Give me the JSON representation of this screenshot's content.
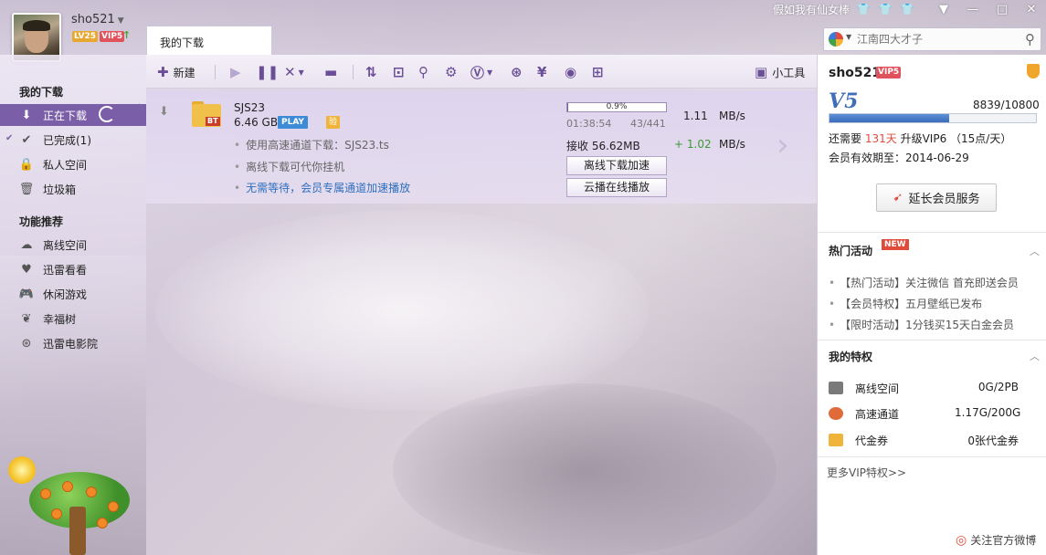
{
  "header": {
    "username": "sho521",
    "level_badge": "LV25",
    "vip_badge": "VIP5",
    "tab_label": "我的下载",
    "marquee": "假如我有仙女棒",
    "search": {
      "placeholder": "江南四大才子"
    }
  },
  "sidebar": {
    "section_downloads": "我的下载",
    "items": [
      {
        "label": "正在下载"
      },
      {
        "label": "已完成(1)"
      },
      {
        "label": "私人空间"
      },
      {
        "label": "垃圾箱"
      }
    ],
    "section_features": "功能推荐",
    "features": [
      {
        "label": "离线空间"
      },
      {
        "label": "迅雷看看"
      },
      {
        "label": "休闲游戏"
      },
      {
        "label": "幸福树"
      },
      {
        "label": "迅雷电影院"
      }
    ]
  },
  "toolbar": {
    "new_label": "新建",
    "tools_label": "小工具"
  },
  "task": {
    "name": "SJS23",
    "size": "6.46 GB",
    "play_badge": "PLAY",
    "verify_badge": "验",
    "tips": [
      "使用高速通道下载：SJS23.ts",
      "离线下载可代你挂机",
      "无需等待，会员专属通道加速播放"
    ],
    "progress": 0.009,
    "progress_text": "0.9%",
    "eta": "01:38:54",
    "blocks": "43/441",
    "speed": "1.11",
    "speed_unit": "MB/s",
    "received": "接收 56.62MB",
    "boost": "+ 1.02",
    "boost_unit": "MB/s",
    "btn_offline": "离线下载加速",
    "btn_cloud": "云播在线播放"
  },
  "vip_panel": {
    "username": "sho521",
    "vip_badge": "VIP5",
    "level": "V5",
    "score": "8839/10800",
    "score_fraction": 0.58,
    "need_prefix": "还需要",
    "need_days": "131天",
    "need_suffix": "升级VIP6 （15点/天）",
    "expiry": "会员有效期至：2014-06-29",
    "extend_button": "延长会员服务",
    "hot_title": "热门活动",
    "new_badge": "NEW",
    "news": [
      "【热门活动】关注微信 首充即送会员",
      "【会员特权】五月壁纸已发布",
      "【限时活动】1分钱买15天白金会员"
    ],
    "priv_title": "我的特权",
    "privileges": [
      {
        "label": "离线空间",
        "value": "0G/2PB"
      },
      {
        "label": "高速通道",
        "value": "1.17G/200G"
      },
      {
        "label": "代金券",
        "value": "0张代金券"
      }
    ],
    "more_link": "更多VIP特权>>",
    "weibo_link": "关注官方微博"
  },
  "colors": {
    "accent": "#7b5ea8",
    "link": "#2f6fbd",
    "boost_green": "#3b9a36",
    "warn_red": "#e04b3a"
  }
}
